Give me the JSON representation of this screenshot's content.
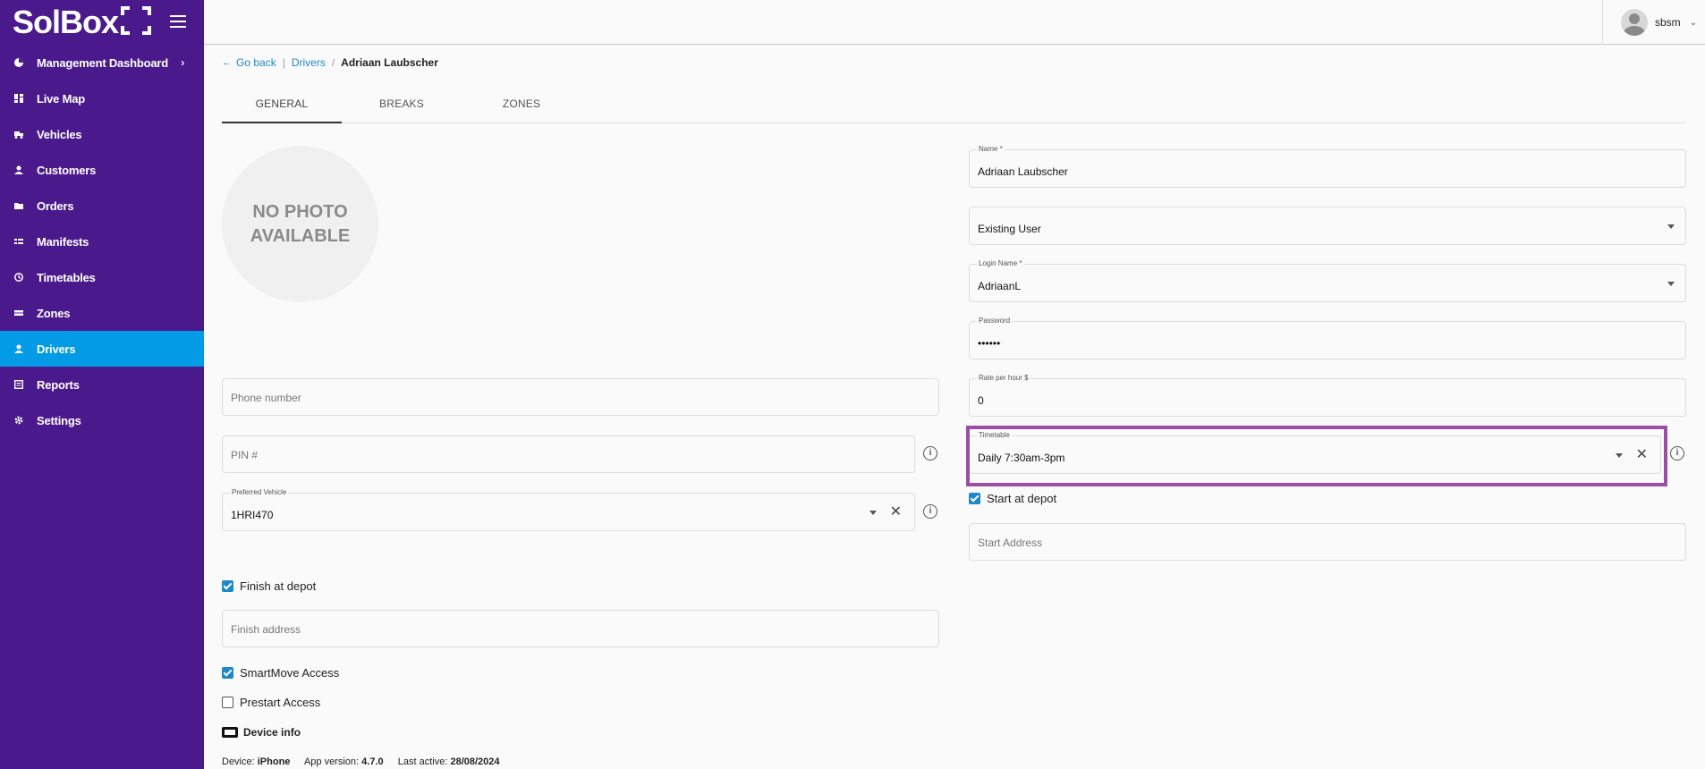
{
  "app": {
    "logo": "SolBox"
  },
  "sidebar": {
    "items": [
      {
        "label": "Management Dashboard",
        "icon": "pie-chart-icon",
        "has_chevron": true
      },
      {
        "label": "Live Map",
        "icon": "dashboard-icon"
      },
      {
        "label": "Vehicles",
        "icon": "truck-icon"
      },
      {
        "label": "Customers",
        "icon": "person-icon"
      },
      {
        "label": "Orders",
        "icon": "folder-icon"
      },
      {
        "label": "Manifests",
        "icon": "list-icon"
      },
      {
        "label": "Timetables",
        "icon": "clock-icon"
      },
      {
        "label": "Zones",
        "icon": "zone-icon"
      },
      {
        "label": "Drivers",
        "icon": "person-icon",
        "active": true
      },
      {
        "label": "Reports",
        "icon": "report-icon"
      },
      {
        "label": "Settings",
        "icon": "gear-icon"
      }
    ]
  },
  "header": {
    "user_name": "sbsm"
  },
  "breadcrumb": {
    "go_back": "Go back",
    "parent": "Drivers",
    "current": "Adriaan Laubscher"
  },
  "tabs": [
    {
      "label": "GENERAL",
      "active": true
    },
    {
      "label": "BREAKS"
    },
    {
      "label": "ZONES"
    }
  ],
  "photo": {
    "line1": "NO PHOTO",
    "line2": "AVAILABLE"
  },
  "form": {
    "name": {
      "label": "Name *",
      "value": "Adriaan Laubscher"
    },
    "user_type": {
      "value": "Existing User"
    },
    "login_name": {
      "label": "Login Name *",
      "value": "AdriaanL"
    },
    "password": {
      "label": "Password",
      "value": "••••••"
    },
    "rate": {
      "label": "Rate per hour $",
      "value": "0"
    },
    "timetable": {
      "label": "Timetable",
      "value": "Daily 7:30am-3pm"
    },
    "phone": {
      "placeholder": "Phone number"
    },
    "pin": {
      "placeholder": "PIN #"
    },
    "preferred_vehicle": {
      "label": "Preferred Vehicle",
      "value": "1HRI470"
    },
    "start_at_depot": {
      "label": "Start at depot",
      "checked": true
    },
    "start_address": {
      "placeholder": "Start Address"
    },
    "finish_at_depot": {
      "label": "Finish at depot",
      "checked": true
    },
    "finish_address": {
      "placeholder": "Finish address"
    },
    "smartmove_access": {
      "label": "SmartMove Access",
      "checked": true
    },
    "prestart_access": {
      "label": "Prestart Access",
      "checked": false
    }
  },
  "device": {
    "title": "Device info",
    "device_label": "Device:",
    "device_value": "iPhone",
    "app_version_label": "App version:",
    "app_version_value": "4.7.0",
    "last_active_label": "Last active:",
    "last_active_value": "28/08/2024"
  },
  "colors": {
    "sidebar": "#4a1a8c",
    "active_nav": "#039be5",
    "link": "#1e88c8",
    "highlight": "#9b4ea5"
  }
}
